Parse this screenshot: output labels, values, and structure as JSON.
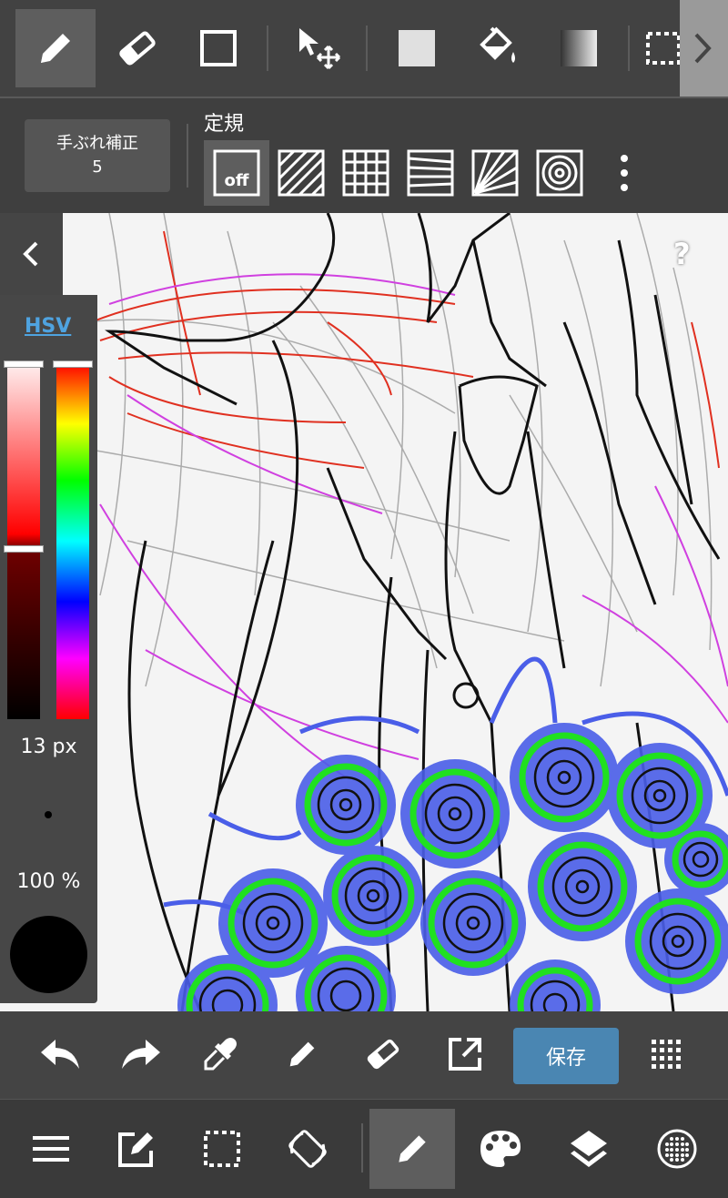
{
  "top_toolbar": {
    "tools": [
      "pen-tool",
      "eraser-tool",
      "shape-tool",
      "move-tool",
      "fill-rect-tool",
      "bucket-tool",
      "gradient-tool",
      "selection-tool"
    ],
    "active": "pen-tool"
  },
  "stabilizer": {
    "label": "手ぶれ補正",
    "value": "5"
  },
  "ruler": {
    "label": "定規",
    "off_label": "off",
    "options": [
      "ruler-off",
      "parallel-ruler",
      "grid-ruler",
      "perspective-ruler",
      "radial-ruler",
      "concentric-ruler"
    ]
  },
  "color_panel": {
    "mode_label": "HSV",
    "brush_size": "13 px",
    "opacity": "100 %",
    "current_color": "#000000"
  },
  "action_bar": {
    "save_label": "保存"
  },
  "bottom_bar": {
    "items": [
      "menu-icon",
      "edit-icon",
      "selection-icon",
      "rotate-icon",
      "brush-icon",
      "palette-icon",
      "layers-icon",
      "material-icon"
    ],
    "active": "brush-icon"
  },
  "colors": {
    "accent": "#4a86b2",
    "toolbar": "#424242",
    "active_tool": "#5e5e5e"
  }
}
